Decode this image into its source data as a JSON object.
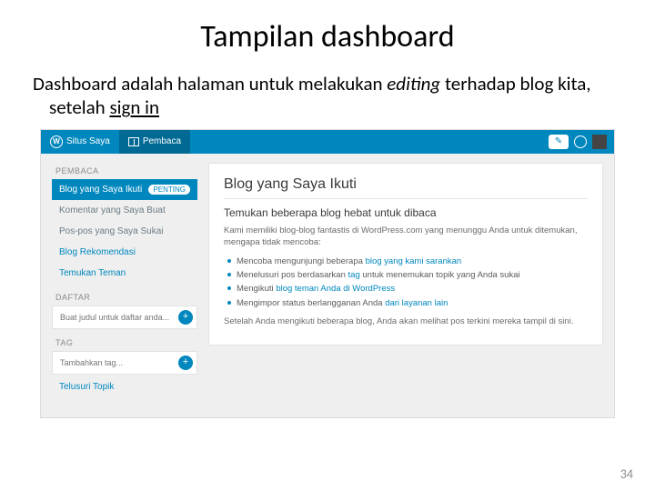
{
  "slide": {
    "title": "Tampilan dashboard",
    "desc_pre": "Dashboard adalah halaman untuk melakukan ",
    "desc_em": "editing",
    "desc_mid": " terhadap blog kita, setelah ",
    "desc_ul": "sign in",
    "page_number": "34"
  },
  "topbar": {
    "wp_mark": "W",
    "my_sites": "Situs Saya",
    "reader": "Pembaca",
    "edit_icon": "✎"
  },
  "sidebar": {
    "label_pembaca": "PEMBACA",
    "items": [
      {
        "label": "Blog yang Saya Ikuti",
        "badge": "PENTING"
      },
      {
        "label": "Komentar yang Saya Buat"
      },
      {
        "label": "Pos-pos yang Saya Sukai"
      },
      {
        "label": "Blog Rekomendasi"
      },
      {
        "label": "Temukan Teman"
      }
    ],
    "label_daftar": "DAFTAR",
    "daftar_placeholder": "Buat judul untuk daftar anda...",
    "label_tag": "TAG",
    "tag_placeholder": "Tambahkan tag...",
    "telusuri": "Telusuri Topik"
  },
  "main": {
    "title": "Blog yang Saya Ikuti",
    "subheading": "Temukan beberapa blog hebat untuk dibaca",
    "intro": "Kami memiliki blog-blog fantastis di WordPress.com yang menunggu Anda untuk ditemukan, mengapa tidak mencoba:",
    "bullets": [
      {
        "pre": "Mencoba mengunjungi beberapa ",
        "link": "blog yang kami sarankan",
        "post": ""
      },
      {
        "pre": "Menelusuri pos berdasarkan ",
        "link": "tag",
        "post": " untuk menemukan topik yang Anda sukai"
      },
      {
        "pre": "Mengikuti ",
        "link": "blog teman Anda di WordPress",
        "post": ""
      },
      {
        "pre": "Mengimpor status berlangganan Anda ",
        "link": "dari layanan lain",
        "post": ""
      }
    ],
    "closing": "Setelah Anda mengikuti beberapa blog, Anda akan melihat pos terkini mereka tampil di sini."
  }
}
